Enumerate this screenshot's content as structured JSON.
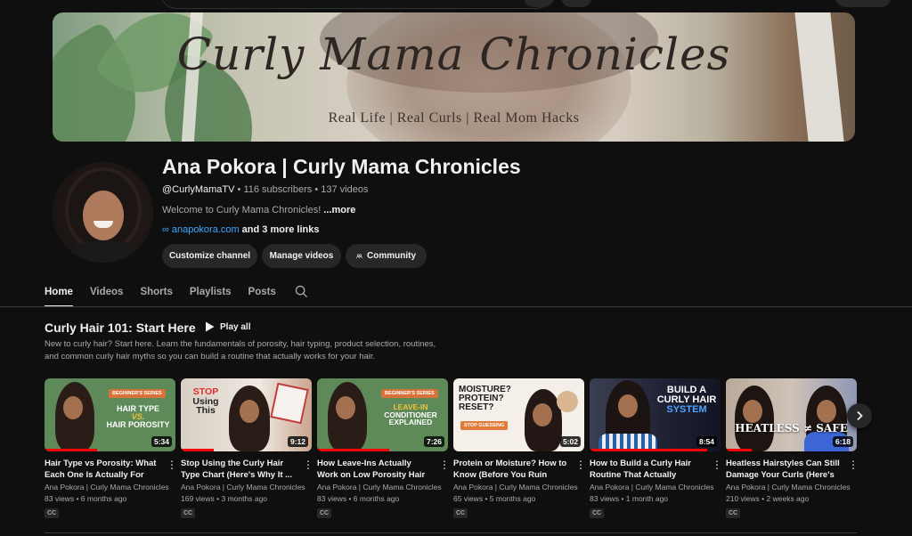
{
  "banner": {
    "title": "Curly Mama Chronicles",
    "tagline": "Real Life | Real Curls | Real Mom Hacks"
  },
  "channel": {
    "name": "Ana Pokora | Curly Mama Chronicles",
    "handle": "@CurlyMamaTV",
    "subscribers": "116 subscribers",
    "videos_count": "137 videos",
    "description": "Welcome to Curly Mama Chronicles!",
    "more_label": "...more",
    "link": "anapokora.com",
    "more_links": "and 3 more links"
  },
  "actions": {
    "customize": "Customize channel",
    "manage": "Manage videos",
    "community": "Community"
  },
  "tabs": [
    {
      "label": "Home",
      "active": true
    },
    {
      "label": "Videos"
    },
    {
      "label": "Shorts"
    },
    {
      "label": "Playlists"
    },
    {
      "label": "Posts"
    }
  ],
  "section": {
    "title": "Curly Hair 101: Start Here",
    "play_all": "Play all",
    "description": "New to curly hair? Start here. Learn the fundamentals of porosity, hair typing, product selection, routines, and common curly hair myths so you can build a routine that actually works for your hair."
  },
  "videos": [
    {
      "title": "Hair Type vs Porosity: What Each One Is Actually For",
      "channel": "Ana Pokora | Curly Mama Chronicles",
      "views": "83 views",
      "age": "6 months ago",
      "duration": "5:34",
      "cc": "CC",
      "thumb_tag": "BEGINNER'S SERIES",
      "thumb_line1": "HAIR TYPE",
      "thumb_line2": "VS.",
      "thumb_line3": "HAIR POROSITY",
      "progress": 0.4
    },
    {
      "title": "Stop Using the Curly Hair Type Chart (Here's Why It ...",
      "channel": "Ana Pokora | Curly Mama Chronicles",
      "views": "169 views",
      "age": "3 months ago",
      "duration": "9:12",
      "cc": "CC",
      "thumb_line1": "STOP",
      "thumb_line2": "Using",
      "thumb_line3": "This",
      "progress": 0.25
    },
    {
      "title": "How Leave-Ins Actually Work on Low Porosity Hair (Water...",
      "channel": "Ana Pokora | Curly Mama Chronicles",
      "views": "83 views",
      "age": "6 months ago",
      "duration": "7:26",
      "cc": "CC",
      "thumb_tag": "BEGINNER'S SERIES",
      "thumb_line1": "LEAVE-IN",
      "thumb_line2": "CONDITIONER",
      "thumb_line3": "EXPLAINED",
      "progress": 0.55
    },
    {
      "title": "Protein or Moisture? How to Know (Before You Ruin Your...",
      "channel": "Ana Pokora | Curly Mama Chronicles",
      "views": "65 views",
      "age": "5 months ago",
      "duration": "5:02",
      "cc": "CC",
      "thumb_line1": "MOISTURE?",
      "thumb_line2": "PROTEIN?",
      "thumb_line3": "RESET?",
      "thumb_tag": "STOP GUESSING",
      "progress": 0.0
    },
    {
      "title": "How to Build a Curly Hair Routine That Actually Make...",
      "channel": "Ana Pokora | Curly Mama Chronicles",
      "views": "83 views",
      "age": "1 month ago",
      "duration": "8:54",
      "cc": "CC",
      "thumb_line1": "BUILD A",
      "thumb_line2": "CURLY HAIR",
      "thumb_line3": "SYSTEM",
      "progress": 0.9
    },
    {
      "title": "Heatless Hairstyles Can Still Damage Your Curls (Here's ...",
      "channel": "Ana Pokora | Curly Mama Chronicles",
      "views": "210 views",
      "age": "2 weeks ago",
      "duration": "6:18",
      "cc": "CC",
      "thumb_line1": "HEATLESS ≠ SAFE",
      "progress": 0.2
    }
  ],
  "colors": {
    "background": "#0f0f0f",
    "chip": "#272727",
    "link": "#3ea6ff",
    "progress": "#ff0000"
  }
}
